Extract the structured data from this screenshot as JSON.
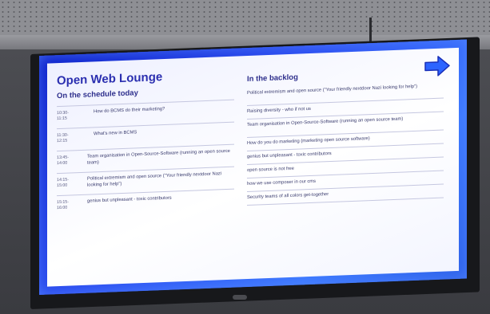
{
  "room_title": "Open Web Lounge",
  "schedule": {
    "heading": "On the schedule today",
    "items": [
      {
        "time": "10:30-\n11:15",
        "talk": "How do BCMS do their marketing?"
      },
      {
        "time": "11:30-\n12:15",
        "talk": "What's new in BCMS"
      },
      {
        "time": "13:45-\n14:00",
        "talk": "Team organisation in Open-Source-Software (running an open source team)"
      },
      {
        "time": "14:15-\n15:00",
        "talk": "Political extremism and open source (\"Your friendly nextdoor Nazi looking for help\")"
      },
      {
        "time": "15:15-\n16:00",
        "talk": "genius but unpleasant - toxic contributors"
      }
    ]
  },
  "backlog": {
    "heading": "In the backlog",
    "items": [
      "Political extremism and open source (\"Your friendly nextdoor Nazi looking for help\")",
      "Raising diversity - who if not us",
      "Team organisation in Open-Source-Software (running an open source team)",
      "How do you do marketing (marketing open source software)",
      "genius but unpleasant - toxic contributors",
      "open source is not free",
      "how we use composer in our cms",
      "Security teams of all colors get-together"
    ]
  },
  "colors": {
    "screen_frame": "#2a4bf0",
    "title_text": "#2b2fb0",
    "arrow": "#2d64ff"
  },
  "icons": {
    "next": "arrow-right-icon"
  }
}
